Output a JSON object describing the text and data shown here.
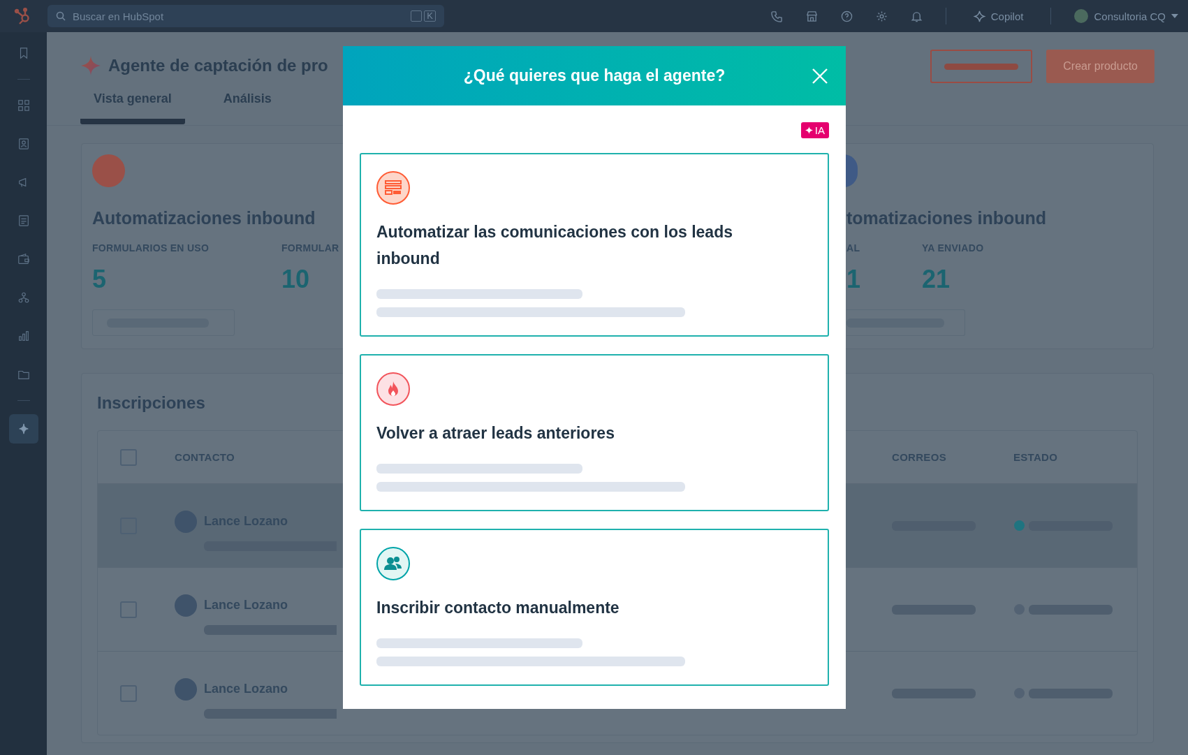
{
  "topbar": {
    "search": {
      "placeholder": "Buscar en HubSpot",
      "shortcut_key": "K"
    },
    "copilot": "Copilot",
    "account": "Consultoria CQ"
  },
  "sidebar": {
    "items": [
      {
        "selected": false
      },
      {
        "selected": false
      },
      {
        "selected": false
      },
      {
        "selected": false
      },
      {
        "selected": false
      },
      {
        "selected": false
      },
      {
        "selected": false
      },
      {
        "selected": false
      },
      {
        "selected": false
      },
      {
        "selected": true
      }
    ]
  },
  "header": {
    "title": "Agente de captación de pro",
    "tabs": [
      {
        "label": "Vista general",
        "selected": true
      },
      {
        "label": "Análisis",
        "selected": false
      }
    ],
    "buttons": [
      {
        "kind": "skeleton"
      },
      {
        "kind": "primary",
        "label": "Crear producto"
      }
    ]
  },
  "stats": {
    "left": {
      "title": "Automatizaciones inbound",
      "metrics": [
        {
          "label": "FORMULARIOS EN USO",
          "value": "5"
        },
        {
          "label": "FORMULAR",
          "value": "10"
        }
      ]
    },
    "right": {
      "title": "tomatizaciones inbound",
      "metrics": [
        {
          "label": "AL",
          "value": "1"
        },
        {
          "label": "YA ENVIADO",
          "value": "21"
        }
      ]
    }
  },
  "enrollments": {
    "title": "Inscripciones",
    "header_checked": false,
    "columns": [
      "CONTACTO",
      "CORREOS",
      "ESTADO"
    ],
    "rows": [
      {
        "name": "Lance Lozano",
        "checked": false,
        "highlighted": true,
        "color": "#1f7480"
      },
      {
        "name": "Lance Lozano",
        "checked": false,
        "highlighted": false,
        "color": "#536273"
      },
      {
        "name": "Lance Lozano",
        "checked": false,
        "highlighted": false,
        "color": "#536273"
      }
    ]
  },
  "modal": {
    "title": "¿Qué quieres que haga el agente?",
    "badge": "IA",
    "options": [
      {
        "kind": "form",
        "title": "Automatizar las comunicaciones con los leads inbound"
      },
      {
        "kind": "fire",
        "title": "Volver a atraer leads anteriores"
      },
      {
        "kind": "people",
        "title": "Inscribir contacto manualmente"
      }
    ]
  }
}
